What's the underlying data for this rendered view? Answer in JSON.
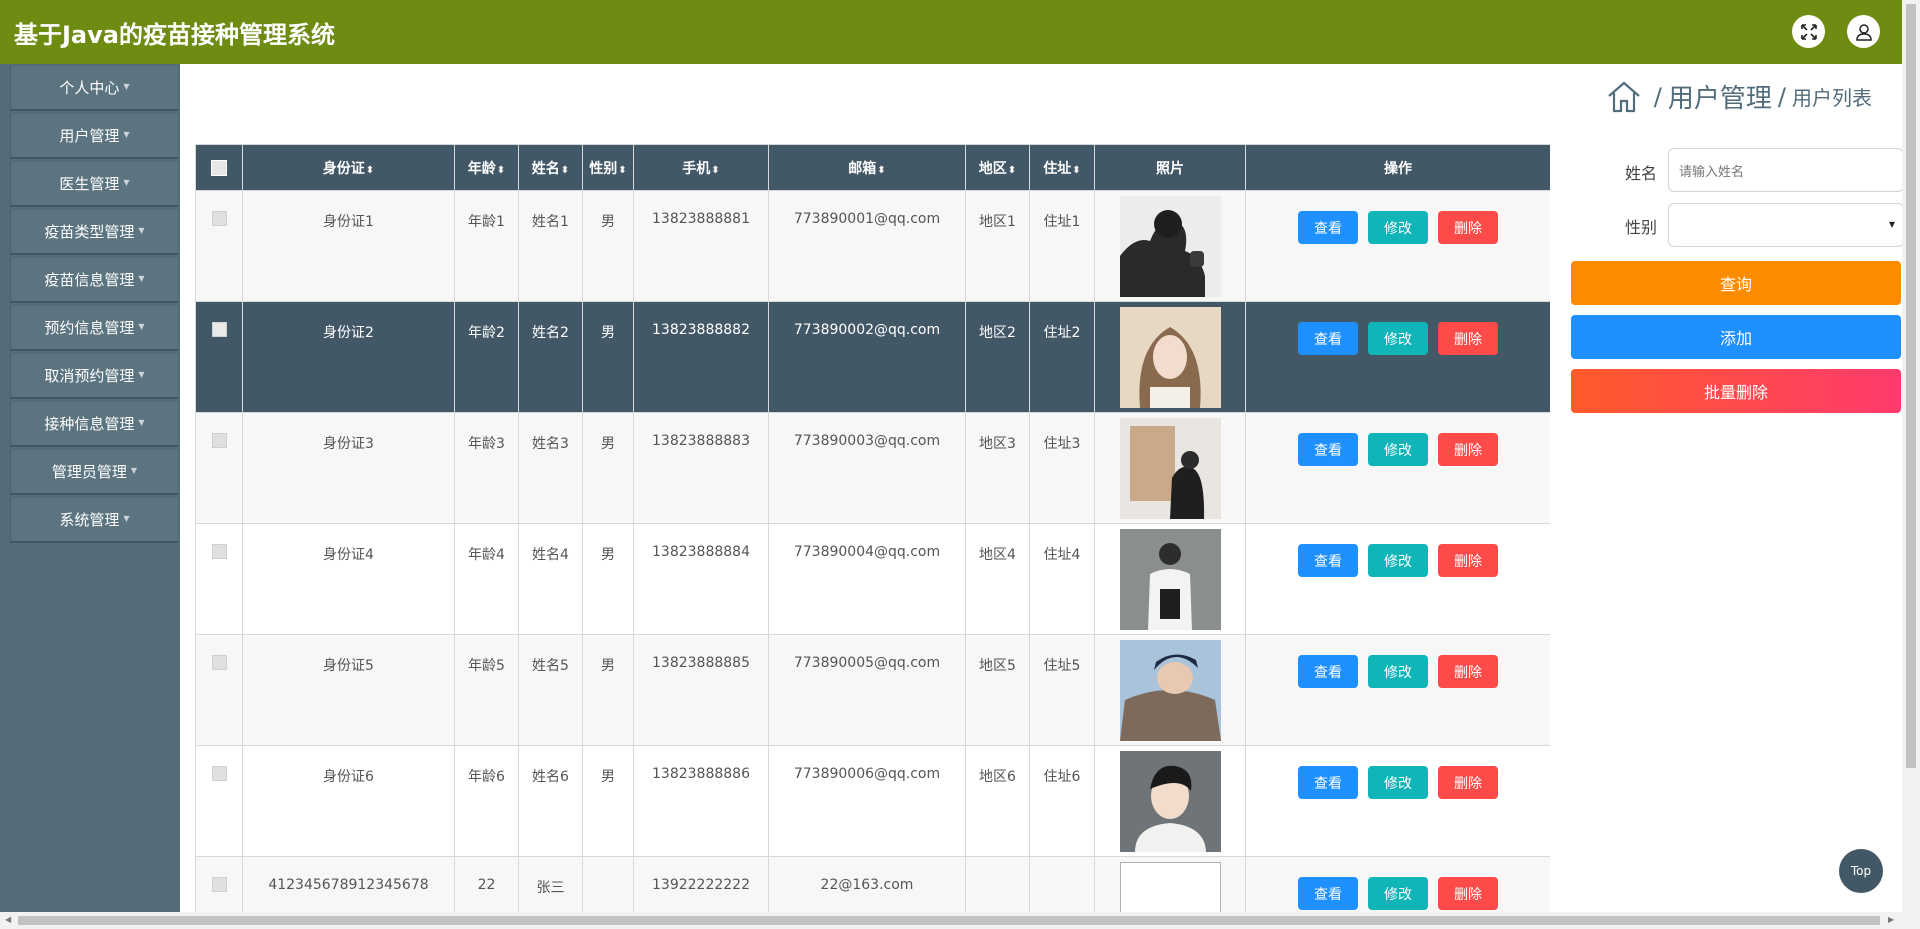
{
  "app": {
    "title": "基于Java的疫苗接种管理系统"
  },
  "header": {
    "fullscreen_icon": "expand-icon",
    "user_icon": "user-icon"
  },
  "sidebar": {
    "items": [
      {
        "label": "个人中心"
      },
      {
        "label": "用户管理"
      },
      {
        "label": "医生管理"
      },
      {
        "label": "疫苗类型管理"
      },
      {
        "label": "疫苗信息管理"
      },
      {
        "label": "预约信息管理"
      },
      {
        "label": "取消预约管理"
      },
      {
        "label": "接种信息管理"
      },
      {
        "label": "管理员管理"
      },
      {
        "label": "系统管理"
      }
    ]
  },
  "breadcrumb": {
    "home_icon": "home-icon",
    "separator": "/",
    "level1": "用户管理",
    "level2": "用户列表"
  },
  "table": {
    "columns": [
      "身份证",
      "年龄",
      "姓名",
      "性别",
      "手机",
      "邮箱",
      "地区",
      "住址",
      "照片",
      "操作"
    ],
    "sort_glyph": "⬍",
    "rows": [
      {
        "id_card": "身份证1",
        "age": "年龄1",
        "name": "姓名1",
        "gender": "男",
        "phone": "13823888881",
        "email": "773890001@qq.com",
        "region": "地区1",
        "address": "住址1"
      },
      {
        "id_card": "身份证2",
        "age": "年龄2",
        "name": "姓名2",
        "gender": "男",
        "phone": "13823888882",
        "email": "773890002@qq.com",
        "region": "地区2",
        "address": "住址2"
      },
      {
        "id_card": "身份证3",
        "age": "年龄3",
        "name": "姓名3",
        "gender": "男",
        "phone": "13823888883",
        "email": "773890003@qq.com",
        "region": "地区3",
        "address": "住址3"
      },
      {
        "id_card": "身份证4",
        "age": "年龄4",
        "name": "姓名4",
        "gender": "男",
        "phone": "13823888884",
        "email": "773890004@qq.com",
        "region": "地区4",
        "address": "住址4"
      },
      {
        "id_card": "身份证5",
        "age": "年龄5",
        "name": "姓名5",
        "gender": "男",
        "phone": "13823888885",
        "email": "773890005@qq.com",
        "region": "地区5",
        "address": "住址5"
      },
      {
        "id_card": "身份证6",
        "age": "年龄6",
        "name": "姓名6",
        "gender": "男",
        "phone": "13823888886",
        "email": "773890006@qq.com",
        "region": "地区6",
        "address": "住址6"
      },
      {
        "id_card": "412345678912345678",
        "age": "22",
        "name": "张三",
        "gender": "",
        "phone": "13922222222",
        "email": "22@163.com",
        "region": "",
        "address": ""
      }
    ],
    "actions": {
      "view": "查看",
      "edit": "修改",
      "delete": "删除"
    }
  },
  "search": {
    "name_label": "姓名",
    "name_placeholder": "请输入姓名",
    "gender_label": "性别",
    "gender_value": "",
    "query_button": "查询",
    "add_button": "添加",
    "batch_delete_button": "批量删除"
  },
  "top_button": "Top",
  "colors": {
    "header": "#6e8b12",
    "sidebar": "#566b78",
    "table_header": "#435866",
    "btn_query": "#ff8c00",
    "btn_add": "#1e90ff",
    "btn_delete": "#ff4a4a",
    "btn_edit": "#10b5b8"
  }
}
